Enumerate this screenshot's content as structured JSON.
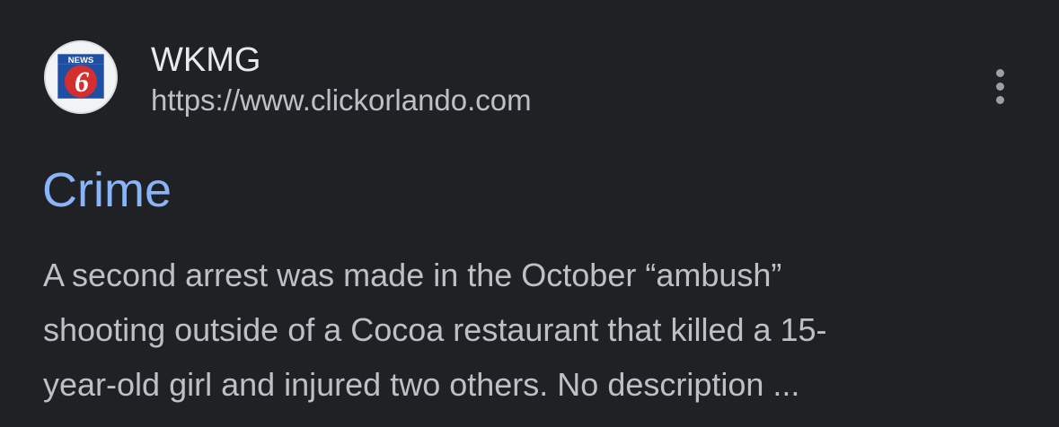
{
  "result": {
    "favicon": {
      "icon": "news-6-logo",
      "badge_text": "NEWS",
      "number": "6"
    },
    "site_name": "WKMG",
    "url": "https://www.clickorlando.com",
    "menu_icon": "more-vert-icon",
    "title": "Crime",
    "snippet_lines": [
      "A second arrest was made in the October “ambush”",
      "shooting outside of a Cocoa restaurant that killed a 15-",
      "year-old girl and injured two others. No description ..."
    ]
  },
  "colors": {
    "background": "#202124",
    "title": "#8ab4f8",
    "site_name": "#e8eaed",
    "text": "#bdc1c6",
    "logo_red": "#d32f2f",
    "logo_blue": "#1e4fa3"
  }
}
